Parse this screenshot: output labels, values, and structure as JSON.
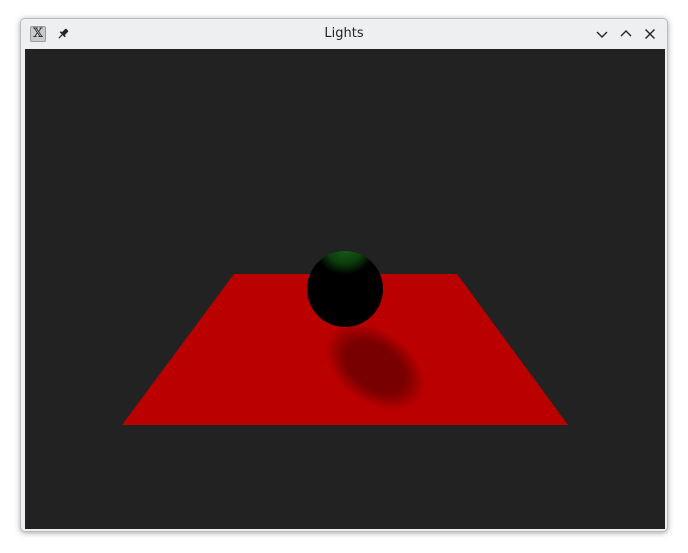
{
  "window": {
    "title": "Lights",
    "icons": {
      "app": "x-window-icon",
      "pin": "pin-icon",
      "minimize": "chevron-down-icon",
      "maximize": "chevron-up-icon",
      "close": "close-icon"
    }
  },
  "scene": {
    "background_color": "#222222",
    "plane_color": "#bb0000",
    "shadow_color": "#770000",
    "sphere_color": "#000000",
    "sphere_highlight_color": "#115511"
  }
}
